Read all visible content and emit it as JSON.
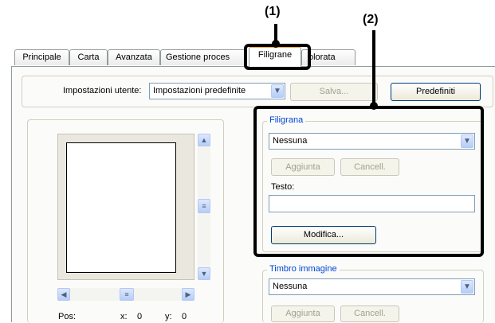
{
  "callouts": {
    "c1": "(1)",
    "c2": "(2)"
  },
  "tabs": [
    {
      "label": "Principale"
    },
    {
      "label": "Carta"
    },
    {
      "label": "Avanzata"
    },
    {
      "label": "Gestione proces"
    },
    {
      "label": "Filigrane"
    },
    {
      "label": "olorata"
    }
  ],
  "settings": {
    "label": "Impostazioni utente:",
    "value": "Impostazioni predefinite",
    "save_label": "Salva...",
    "defaults_label": "Predefiniti"
  },
  "watermark": {
    "legend": "Filigrana",
    "value": "Nessuna",
    "add_label": "Aggiunta",
    "cancel_label": "Cancell.",
    "text_label": "Testo:",
    "text_value": "",
    "edit_label": "Modifica..."
  },
  "image_stamp": {
    "legend": "Timbro immagine",
    "value": "Nessuna",
    "add_label": "Aggiunta",
    "cancel_label": "Cancell."
  },
  "preview": {
    "pos_label": "Pos:",
    "x_label": "x:",
    "x_value": "0",
    "y_label": "y:",
    "y_value": "0"
  }
}
